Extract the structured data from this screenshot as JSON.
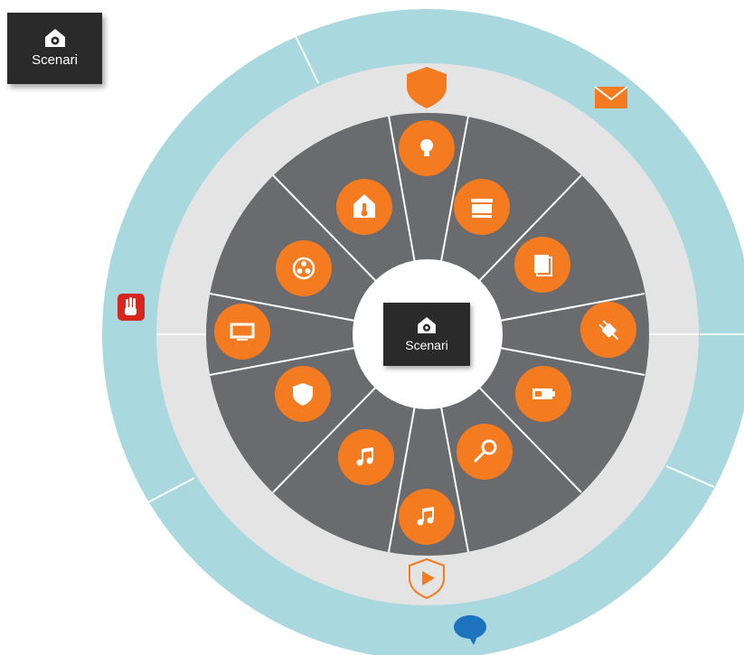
{
  "corner_tile": {
    "label": "Scenari",
    "icon": "home-gear-icon"
  },
  "center_tile": {
    "label": "Scenari",
    "icon": "home-gear-icon"
  },
  "colors": {
    "outer_ring": "#a9d8df",
    "middle_ring": "#e4e4e4",
    "segments": "#696b6e",
    "accent": "#f47b20",
    "tile_bg": "#2a2a2a",
    "alert_red": "#d7261e",
    "chat_blue": "#1e73be"
  },
  "wheel_buttons": [
    {
      "name": "lightbulb-button",
      "icon": "lightbulb-icon"
    },
    {
      "name": "blinds-button",
      "icon": "blinds-icon"
    },
    {
      "name": "document-button",
      "icon": "document-icon"
    },
    {
      "name": "energy-plug-button",
      "icon": "plug-icon"
    },
    {
      "name": "battery-button",
      "icon": "battery-icon"
    },
    {
      "name": "key-button",
      "icon": "key-icon"
    },
    {
      "name": "music-button-bottom",
      "icon": "music-note-icon"
    },
    {
      "name": "music-button-lower-left",
      "icon": "music-note-icon"
    },
    {
      "name": "security-shield-button",
      "icon": "shield-icon"
    },
    {
      "name": "tv-button",
      "icon": "tv-icon"
    },
    {
      "name": "fan-button",
      "icon": "fan-icon"
    },
    {
      "name": "thermostat-button",
      "icon": "thermometer-house-icon"
    }
  ],
  "ring_icons": [
    {
      "name": "alarm-shield-icon",
      "icon": "shield-icon"
    },
    {
      "name": "mail-icon",
      "icon": "envelope-icon"
    },
    {
      "name": "stop-hand-icon",
      "icon": "hand-icon"
    },
    {
      "name": "play-shield-icon",
      "icon": "play-icon"
    },
    {
      "name": "chat-icon",
      "icon": "speech-bubble-icon"
    }
  ]
}
